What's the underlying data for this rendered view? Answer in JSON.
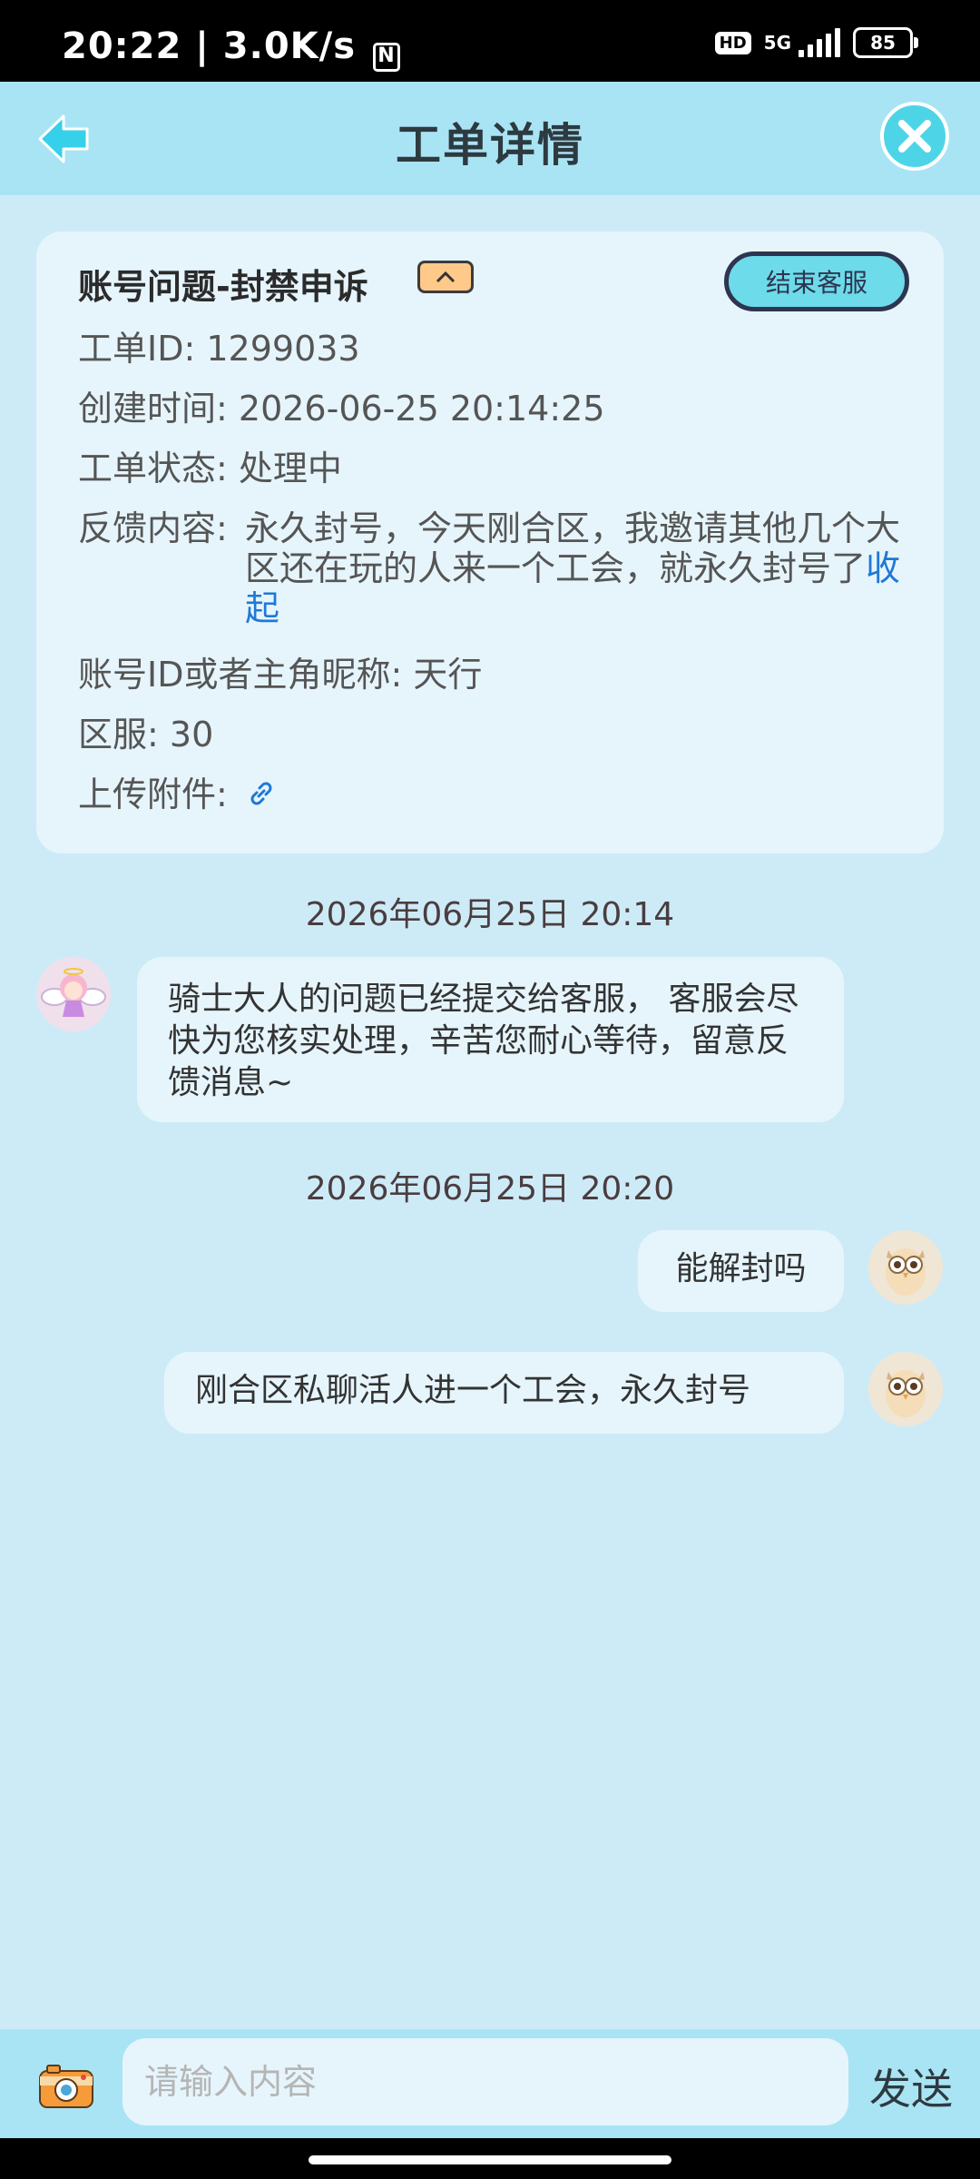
{
  "status_bar": {
    "time": "20:22",
    "speed": "| 3.0K/s",
    "hd": "HD",
    "network": "5G",
    "battery": "85"
  },
  "header": {
    "title": "工单详情"
  },
  "ticket": {
    "title": "账号问题-封禁申诉",
    "end_button": "结束客服",
    "id_label": "工单ID:",
    "id_value": "1299033",
    "created_label": "创建时间:",
    "created_value": "2026-06-25 20:14:25",
    "status_label": "工单状态:",
    "status_value": "处理中",
    "feedback_label": "反馈内容:",
    "feedback_value": "永久封号，今天刚合区，我邀请其他几个大区还在玩的人来一个工会，就永久封号了",
    "collapse_label": "收起",
    "account_label": "账号ID或者主角昵称:",
    "account_value": "天行",
    "server_label": "区服:",
    "server_value": "30",
    "attachment_label": "上传附件:"
  },
  "chat": {
    "date1": "2026年06月25日 20:14",
    "msg1": "骑士大人的问题已经提交给客服， 客服会尽快为您核实处理，辛苦您耐心等待，留意反馈消息~",
    "date2": "2026年06月25日 20:20",
    "msg2": "能解封吗",
    "msg3": "刚合区私聊活人进一个工会，永久封号"
  },
  "input": {
    "placeholder": "请输入内容",
    "send": "发送"
  },
  "colors": {
    "background": "#cdebf7",
    "header": "#a9e4f4",
    "bubble": "#e6f5fc",
    "accent": "#4dd5e7",
    "link": "#1f78d6"
  },
  "icons": [
    "back-arrow-icon",
    "close-icon",
    "chevron-up-icon",
    "link-icon",
    "camera-icon"
  ]
}
